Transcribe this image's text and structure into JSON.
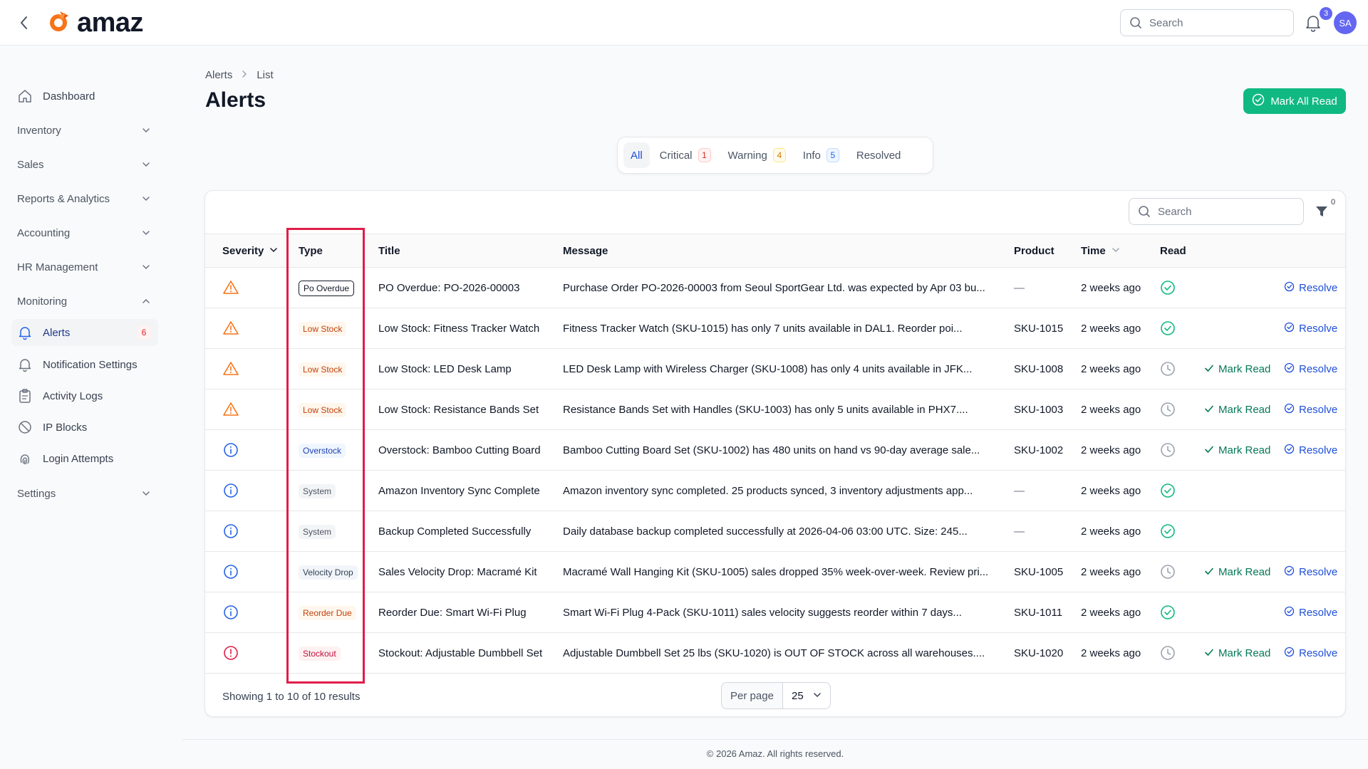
{
  "app": {
    "name": "amaz"
  },
  "header": {
    "search_placeholder": "Search",
    "notification_count": "3",
    "avatar_initials": "SA"
  },
  "sidebar": {
    "items": [
      {
        "label": "Dashboard",
        "icon": "home-icon"
      },
      {
        "label": "Inventory",
        "icon": "chevron-down-icon"
      },
      {
        "label": "Sales",
        "icon": "chevron-down-icon"
      },
      {
        "label": "Reports & Analytics",
        "icon": "chevron-down-icon"
      },
      {
        "label": "Accounting",
        "icon": "chevron-down-icon"
      },
      {
        "label": "HR Management",
        "icon": "chevron-down-icon"
      },
      {
        "label": "Monitoring",
        "icon": "chevron-up-icon"
      },
      {
        "label": "Alerts",
        "icon": "bell-icon",
        "badge": "6"
      },
      {
        "label": "Notification Settings",
        "icon": "bell-icon"
      },
      {
        "label": "Activity Logs",
        "icon": "clipboard-icon"
      },
      {
        "label": "IP Blocks",
        "icon": "ban-icon"
      },
      {
        "label": "Login Attempts",
        "icon": "fingerprint-icon"
      },
      {
        "label": "Settings",
        "icon": "chevron-down-icon"
      }
    ]
  },
  "breadcrumb": {
    "root": "Alerts",
    "current": "List"
  },
  "page": {
    "title": "Alerts",
    "mark_all_label": "Mark All Read"
  },
  "tabs": [
    {
      "label": "All",
      "count": ""
    },
    {
      "label": "Critical",
      "count": "1"
    },
    {
      "label": "Warning",
      "count": "4"
    },
    {
      "label": "Info",
      "count": "5"
    },
    {
      "label": "Resolved",
      "count": ""
    }
  ],
  "table": {
    "search_placeholder": "Search",
    "filter_count": "0",
    "columns": {
      "severity": "Severity",
      "type": "Type",
      "title": "Title",
      "message": "Message",
      "product": "Product",
      "time": "Time",
      "read": "Read"
    },
    "actions": {
      "mark_read": "Mark Read",
      "resolve": "Resolve"
    },
    "rows": [
      {
        "severity": "warning",
        "type": "Po Overdue",
        "title": "PO Overdue: PO-2026-00003",
        "message": "Purchase Order PO-2026-00003 from Seoul SportGear Ltd. was expected by Apr 03 bu...",
        "product": "—",
        "time": "2 weeks ago",
        "read": true
      },
      {
        "severity": "warning",
        "type": "Low Stock",
        "title": "Low Stock: Fitness Tracker Watch",
        "message": "Fitness Tracker Watch (SKU-1015) has only 7 units available in DAL1. Reorder poi...",
        "product": "SKU-1015",
        "time": "2 weeks ago",
        "read": true
      },
      {
        "severity": "warning",
        "type": "Low Stock",
        "title": "Low Stock: LED Desk Lamp",
        "message": "LED Desk Lamp with Wireless Charger (SKU-1008) has only 4 units available in JFK...",
        "product": "SKU-1008",
        "time": "2 weeks ago",
        "read": false
      },
      {
        "severity": "warning",
        "type": "Low Stock",
        "title": "Low Stock: Resistance Bands Set",
        "message": "Resistance Bands Set with Handles (SKU-1003) has only 5 units available in PHX7....",
        "product": "SKU-1003",
        "time": "2 weeks ago",
        "read": false
      },
      {
        "severity": "info",
        "type": "Overstock",
        "title": "Overstock: Bamboo Cutting Board",
        "message": "Bamboo Cutting Board Set (SKU-1002) has 480 units on hand vs 90-day average sale...",
        "product": "SKU-1002",
        "time": "2 weeks ago",
        "read": false
      },
      {
        "severity": "info",
        "type": "System",
        "title": "Amazon Inventory Sync Complete",
        "message": "Amazon inventory sync completed. 25 products synced, 3 inventory adjustments app...",
        "product": "—",
        "time": "2 weeks ago",
        "read": true,
        "resolved": true
      },
      {
        "severity": "info",
        "type": "System",
        "title": "Backup Completed Successfully",
        "message": "Daily database backup completed successfully at 2026-04-06 03:00 UTC. Size: 245...",
        "product": "—",
        "time": "2 weeks ago",
        "read": true,
        "resolved": true
      },
      {
        "severity": "info",
        "type": "Velocity Drop",
        "title": "Sales Velocity Drop: Macramé Kit",
        "message": "Macramé Wall Hanging Kit (SKU-1005) sales dropped 35% week-over-week. Review pri...",
        "product": "SKU-1005",
        "time": "2 weeks ago",
        "read": false
      },
      {
        "severity": "info",
        "type": "Reorder Due",
        "title": "Reorder Due: Smart Wi-Fi Plug",
        "message": "Smart Wi-Fi Plug 4-Pack (SKU-1011) sales velocity suggests reorder within 7 days...",
        "product": "SKU-1011",
        "time": "2 weeks ago",
        "read": true
      },
      {
        "severity": "critical",
        "type": "Stockout",
        "title": "Stockout: Adjustable Dumbbell Set",
        "message": "Adjustable Dumbbell Set 25 lbs (SKU-1020) is OUT OF STOCK across all warehouses....",
        "product": "SKU-1020",
        "time": "2 weeks ago",
        "read": false
      }
    ],
    "showing": "Showing 1 to 10 of 10 results",
    "per_page_label": "Per page",
    "per_page_value": "25"
  },
  "footer": {
    "text": "© 2026 Amaz. All rights reserved."
  },
  "colors": {
    "accent": "#10b981",
    "primary": "#6366f1",
    "warning": "#f97316",
    "info": "#2563eb",
    "critical": "#e11d48",
    "highlight": "#e11d48"
  }
}
